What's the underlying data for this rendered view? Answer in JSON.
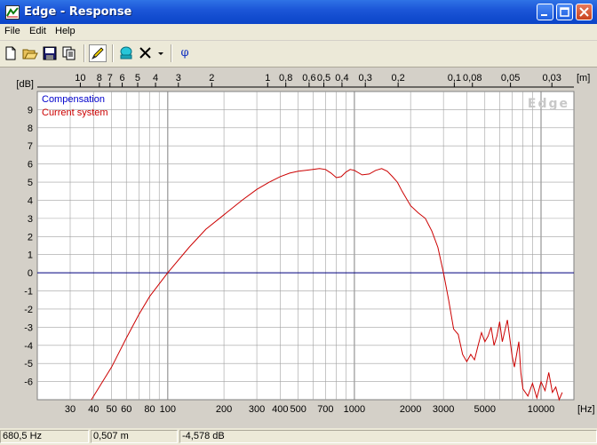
{
  "window": {
    "title": "Edge - Response"
  },
  "menu": [
    "File",
    "Edit",
    "Help"
  ],
  "toolbar": {
    "phase_label": "φ"
  },
  "status": {
    "frequency": "680,5 Hz",
    "distance": "0,507 m",
    "level": "-4,578 dB"
  },
  "colors": {
    "compensation": "#0000cc",
    "current_system": "#cc0000",
    "grid": "#a0a0a0",
    "zero_line": "#000080",
    "plot_bg": "#ffffff"
  },
  "chart_data": {
    "type": "line",
    "watermark": "Edge",
    "xscale": "log",
    "x_unit_label": "[Hz]",
    "x2_unit_label": "[m]",
    "y_unit_label": "[dB]",
    "xlim": [
      20,
      15000
    ],
    "ylim": [
      -7,
      10
    ],
    "yticks": [
      9,
      8,
      7,
      6,
      5,
      4,
      3,
      2,
      1,
      0,
      -1,
      -2,
      -3,
      -4,
      -5,
      -6
    ],
    "xticks": [
      {
        "v": 30,
        "label": "30"
      },
      {
        "v": 40,
        "label": "40"
      },
      {
        "v": 50,
        "label": "50"
      },
      {
        "v": 60,
        "label": "60"
      },
      {
        "v": 80,
        "label": "80"
      },
      {
        "v": 100,
        "label": "100"
      },
      {
        "v": 200,
        "label": "200"
      },
      {
        "v": 300,
        "label": "300"
      },
      {
        "v": 400,
        "label": "400"
      },
      {
        "v": 500,
        "label": "500"
      },
      {
        "v": 700,
        "label": "700"
      },
      {
        "v": 1000,
        "label": "1000"
      },
      {
        "v": 2000,
        "label": "2000"
      },
      {
        "v": 3000,
        "label": "3000"
      },
      {
        "v": 5000,
        "label": "5000"
      },
      {
        "v": 10000,
        "label": "10000"
      }
    ],
    "x2ticks": [
      {
        "label": "10",
        "f": 34
      },
      {
        "label": "8",
        "f": 43
      },
      {
        "label": "7",
        "f": 49
      },
      {
        "label": "6",
        "f": 57
      },
      {
        "label": "5",
        "f": 69
      },
      {
        "label": "4",
        "f": 86
      },
      {
        "label": "3",
        "f": 114
      },
      {
        "label": "2",
        "f": 172
      },
      {
        "label": "1",
        "f": 343
      },
      {
        "label": "0,8",
        "f": 429
      },
      {
        "label": "0,6",
        "f": 572
      },
      {
        "label": "0,5",
        "f": 686
      },
      {
        "label": "0,4",
        "f": 858
      },
      {
        "label": "0,3",
        "f": 1144
      },
      {
        "label": "0,2",
        "f": 1715
      },
      {
        "label": "0,1",
        "f": 3430
      },
      {
        "label": "0,08",
        "f": 4288
      },
      {
        "label": "0,05",
        "f": 6860
      },
      {
        "label": "0,03",
        "f": 11433
      }
    ],
    "series": [
      {
        "name": "Compensation",
        "x": [],
        "y": []
      },
      {
        "name": "Current system",
        "x": [
          39,
          50,
          60,
          70,
          80,
          100,
          130,
          160,
          200,
          250,
          300,
          350,
          400,
          450,
          500,
          550,
          600,
          650,
          700,
          750,
          800,
          850,
          900,
          950,
          1000,
          1100,
          1200,
          1300,
          1400,
          1500,
          1600,
          1700,
          1800,
          2000,
          2200,
          2400,
          2600,
          2800,
          3000,
          3200,
          3400,
          3600,
          3800,
          4000,
          4200,
          4400,
          4600,
          4800,
          5000,
          5200,
          5400,
          5600,
          5800,
          6000,
          6200,
          6400,
          6600,
          6800,
          7000,
          7200,
          7400,
          7600,
          7800,
          8000,
          8500,
          9000,
          9500,
          10000,
          10500,
          11000,
          11500,
          12000,
          12500,
          13000
        ],
        "y": [
          -7.0,
          -5.2,
          -3.6,
          -2.3,
          -1.3,
          0.0,
          1.4,
          2.4,
          3.2,
          4.0,
          4.6,
          5.0,
          5.3,
          5.5,
          5.6,
          5.65,
          5.7,
          5.75,
          5.7,
          5.5,
          5.25,
          5.3,
          5.55,
          5.7,
          5.65,
          5.4,
          5.45,
          5.65,
          5.75,
          5.6,
          5.3,
          5.0,
          4.5,
          3.7,
          3.3,
          3.0,
          2.3,
          1.4,
          0.0,
          -1.5,
          -3.1,
          -3.4,
          -4.5,
          -4.9,
          -4.5,
          -4.8,
          -4.0,
          -3.3,
          -3.8,
          -3.5,
          -3.0,
          -4.0,
          -3.5,
          -2.7,
          -3.8,
          -3.2,
          -2.6,
          -3.6,
          -4.6,
          -5.2,
          -4.5,
          -3.8,
          -5.5,
          -6.4,
          -6.8,
          -6.1,
          -6.9,
          -6.0,
          -6.5,
          -5.5,
          -6.6,
          -6.3,
          -7.0,
          -6.6
        ]
      }
    ],
    "legend_position": "top-left"
  }
}
